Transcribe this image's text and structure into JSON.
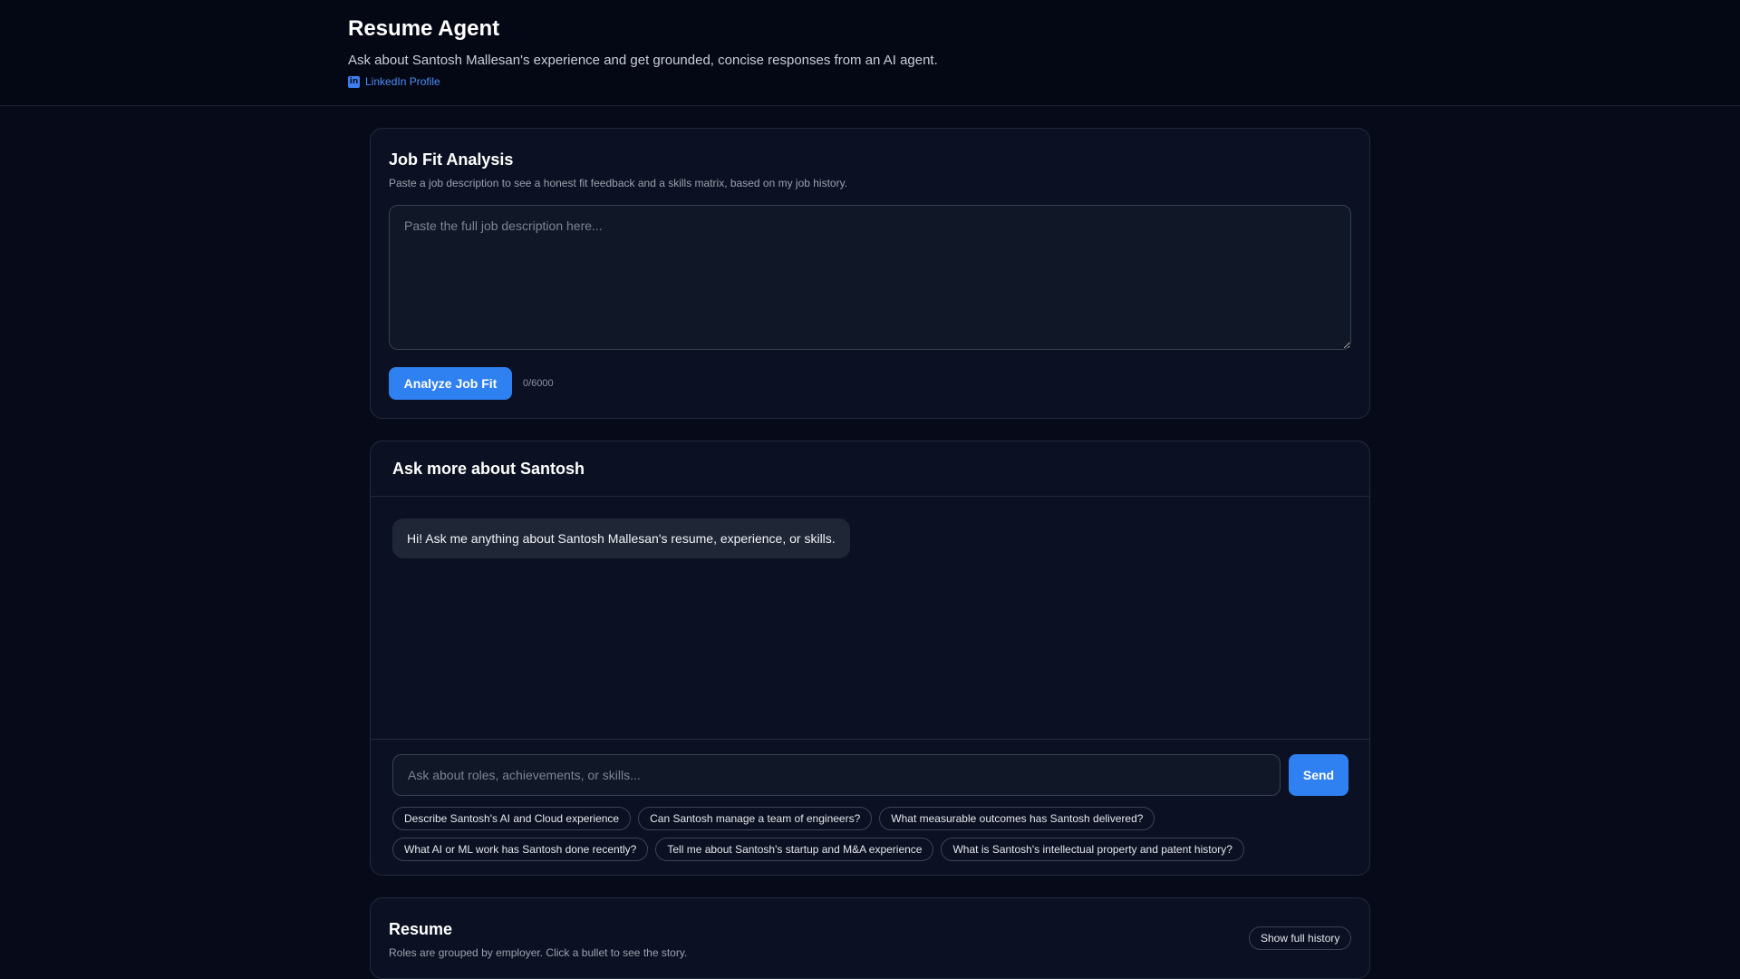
{
  "header": {
    "title": "Resume Agent",
    "subtitle": "Ask about Santosh Mallesan's experience and get grounded, concise responses from an AI agent.",
    "linkedin_label": "LinkedIn Profile",
    "linkedin_icon": "linkedin-icon"
  },
  "job_fit": {
    "title": "Job Fit Analysis",
    "description": "Paste a job description to see a honest fit feedback and a skills matrix, based on my job history.",
    "textarea_value": "",
    "textarea_placeholder": "Paste the full job description here...",
    "analyze_label": "Analyze Job Fit",
    "char_count": "0/6000"
  },
  "chat": {
    "title": "Ask more about Santosh",
    "messages": [
      {
        "role": "assistant",
        "text": "Hi! Ask me anything about Santosh Mallesan's resume, experience, or skills."
      }
    ],
    "input_value": "",
    "input_placeholder": "Ask about roles, achievements, or skills...",
    "send_label": "Send",
    "suggestion_rows": [
      [
        "Describe Santosh's AI and Cloud experience",
        "Can Santosh manage a team of engineers?",
        "What measurable outcomes has Santosh delivered?"
      ],
      [
        "What AI or ML work has Santosh done recently?",
        "Tell me about Santosh's startup and M&A experience",
        "What is Santosh's intellectual property and patent history?"
      ]
    ]
  },
  "resume": {
    "title": "Resume",
    "description": "Roles are grouped by employer. Click a bullet to see the story.",
    "history_button_label": "Show full history"
  },
  "colors": {
    "background": "#070b19",
    "card": "#0b1122",
    "accent": "#2f80f0",
    "link": "#4c8df6"
  }
}
